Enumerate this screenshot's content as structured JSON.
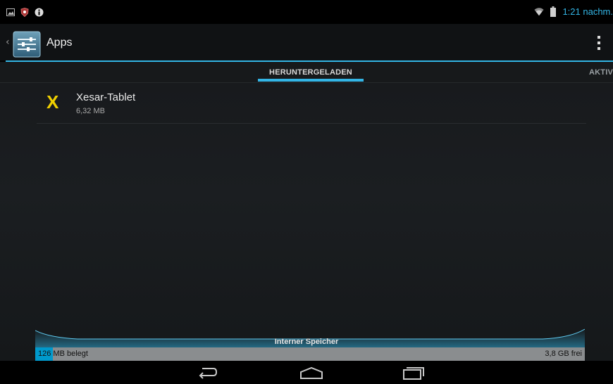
{
  "status_bar": {
    "time": "1:21 nachm.",
    "icons_left": [
      "gallery-icon",
      "shield-icon",
      "info-icon"
    ],
    "icons_right": [
      "wifi-icon",
      "battery-icon"
    ]
  },
  "action_bar": {
    "title": "Apps",
    "icon": "settings-sliders-icon"
  },
  "tabs": [
    {
      "label": "HERUNTERGELADEN",
      "selected": true
    },
    {
      "label": "AKTIV",
      "selected": false
    }
  ],
  "apps": [
    {
      "name": "Xesar-Tablet",
      "size": "6,32 MB",
      "icon": "X"
    }
  ],
  "storage": {
    "label": "Interner Speicher",
    "used": "126 MB belegt",
    "free": "3,8 GB frei",
    "used_fraction": 0.032
  },
  "colors": {
    "accent": "#33b5e5",
    "app_icon": "#f0d000"
  }
}
